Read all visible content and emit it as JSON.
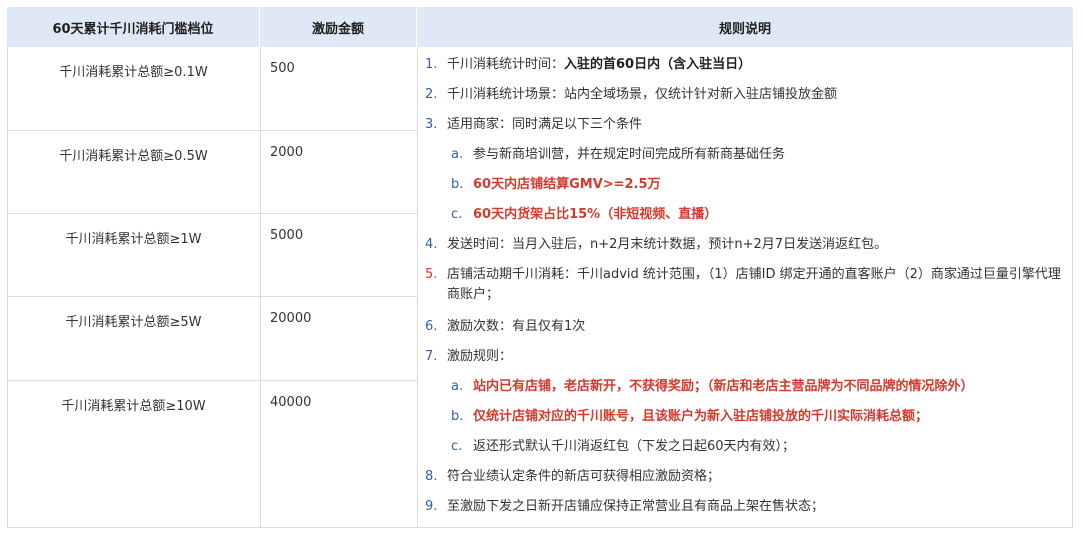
{
  "header": {
    "col1": "60天累计千川消耗门槛档位",
    "col2": "激励金额",
    "col3": "规则说明"
  },
  "tiers": [
    {
      "threshold": "千川消耗累计总额≥0.1W",
      "amount": "500"
    },
    {
      "threshold": "千川消耗累计总额≥0.5W",
      "amount": "2000"
    },
    {
      "threshold": "千川消耗累计总额≥1W",
      "amount": "5000"
    },
    {
      "threshold": "千川消耗累计总额≥5W",
      "amount": "20000"
    },
    {
      "threshold": "千川消耗累计总额≥10W",
      "amount": "40000"
    }
  ],
  "rules": {
    "r1_num": "1.",
    "r1_text": "千川消耗统计时间：",
    "r1_bold": "入驻的首60日内（含入驻当日）",
    "r2_num": "2.",
    "r2_text": "千川消耗统计场景：站内全域场景，仅统计针对新入驻店铺投放金额",
    "r3_num": "3.",
    "r3_text": "适用商家：同时满足以下三个条件",
    "r3a_num": "a.",
    "r3a_text": "参与新商培训营，并在规定时间完成所有新商基础任务",
    "r3b_num": "b.",
    "r3b_text": "60天内店铺结算GMV>=2.5万",
    "r3c_num": "c.",
    "r3c_text": "60天内货架占比15%（非短视频、直播）",
    "r4_num": "4.",
    "r4_text": "发送时间：当月入驻后，n+2月末统计数据，预计n+2月7日发送消返红包。",
    "r5_num": "5.",
    "r5_text": "店铺活动期千川消耗：千川advid 统计范围，（1）店铺ID 绑定开通的直客账户（2）商家通过巨量引擎代理商账户；",
    "r6_num": "6.",
    "r6_text": "激励次数：有且仅有1次",
    "r7_num": "7.",
    "r7_text": "激励规则：",
    "r7a_num": "a.",
    "r7a_text": "站内已有店铺，老店新开，不获得奖励；（新店和老店主营品牌为不同品牌的情况除外）",
    "r7b_num": "b.",
    "r7b_text": "仅统计店铺对应的千川账号，且该账户为新入驻店铺投放的千川实际消耗总额；",
    "r7c_num": "c.",
    "r7c_text": "返还形式默认千川消返红包（下发之日起60天内有效）；",
    "r8_num": "8.",
    "r8_text": " 符合业绩认定条件的新店可获得相应激励资格；",
    "r9_num": "9.",
    "r9_text": "至激励下发之日新开店铺应保持正常营业且有商品上架在售状态；"
  }
}
